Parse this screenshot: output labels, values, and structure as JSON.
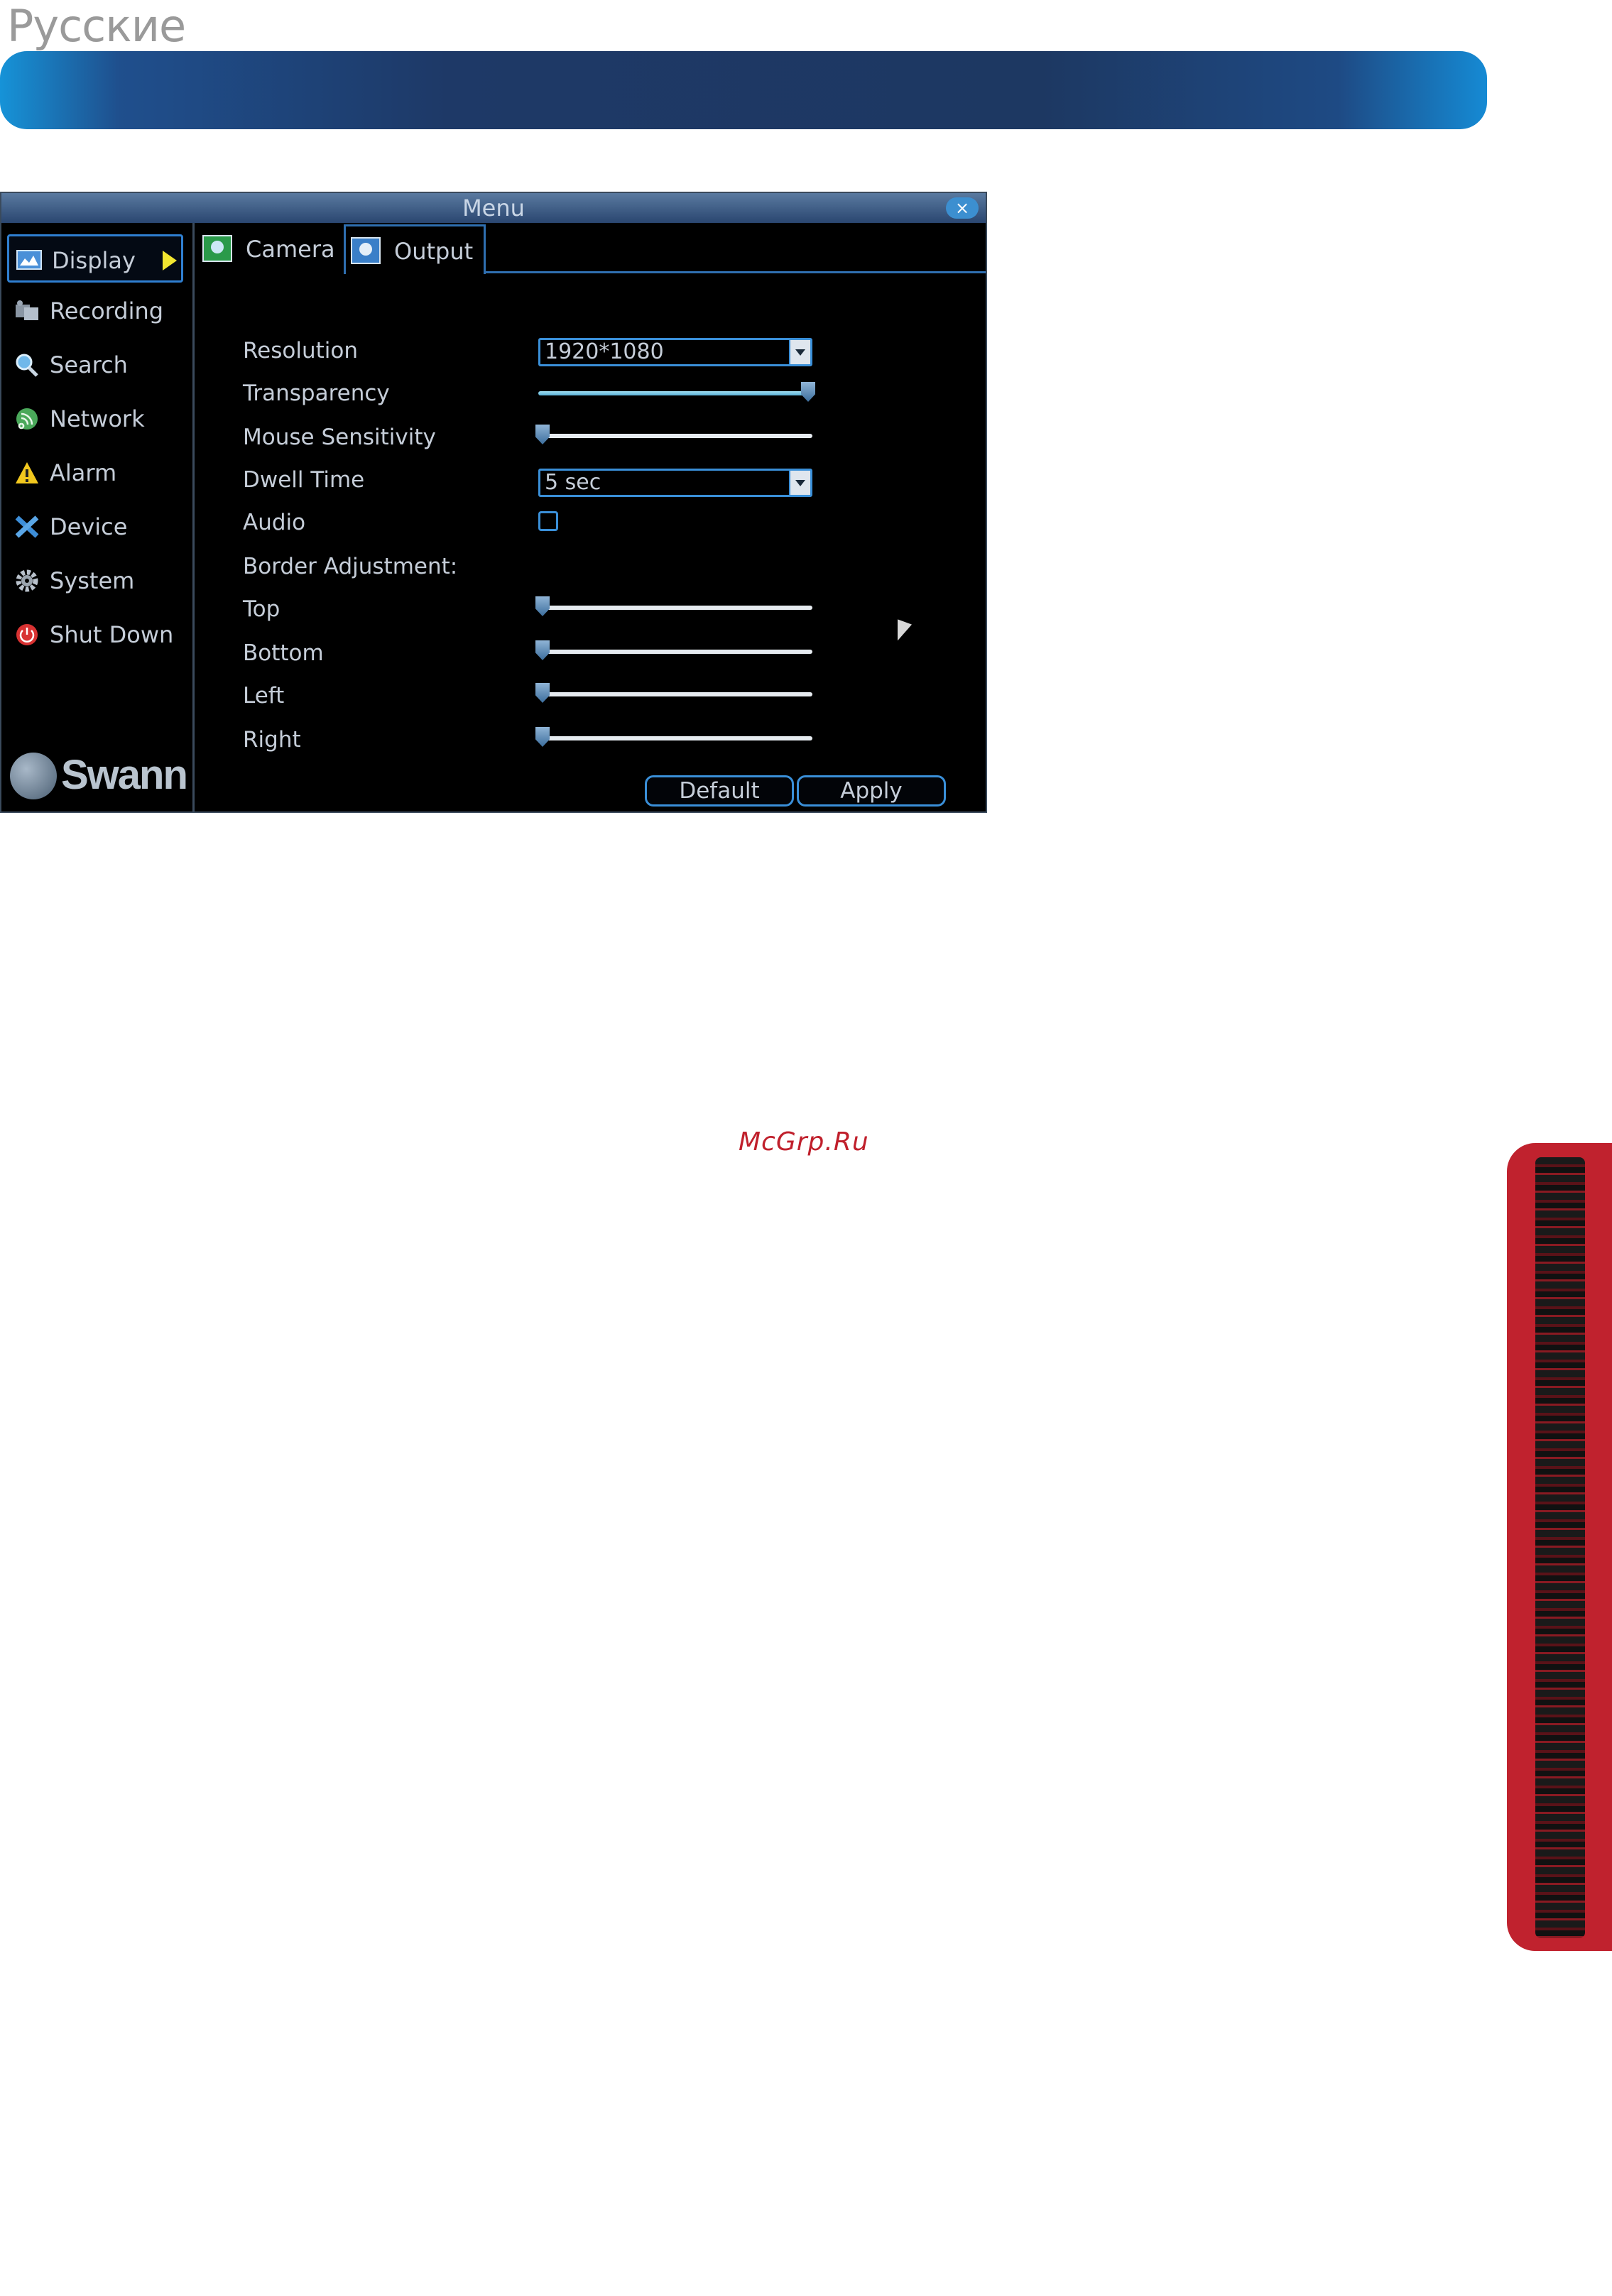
{
  "page": {
    "language_heading": "Русские",
    "watermark": "McGrp.Ru"
  },
  "window": {
    "title": "Menu",
    "close_label": "×"
  },
  "sidebar": {
    "items": [
      {
        "label": "Display",
        "icon": "display-icon",
        "active": true
      },
      {
        "label": "Recording",
        "icon": "recording-icon"
      },
      {
        "label": "Search",
        "icon": "search-icon"
      },
      {
        "label": "Network",
        "icon": "network-icon"
      },
      {
        "label": "Alarm",
        "icon": "alarm-icon"
      },
      {
        "label": "Device",
        "icon": "device-icon"
      },
      {
        "label": "System",
        "icon": "gear-icon"
      },
      {
        "label": "Shut Down",
        "icon": "power-icon"
      }
    ],
    "logo_text": "Swann"
  },
  "tabs": [
    {
      "label": "Camera",
      "icon": "camera-tab-icon",
      "active": false
    },
    {
      "label": "Output",
      "icon": "output-tab-icon",
      "active": true
    }
  ],
  "form": {
    "resolution": {
      "label": "Resolution",
      "value": "1920*1080"
    },
    "transparency": {
      "label": "Transparency",
      "level": 1.0
    },
    "mouse_sensitivity": {
      "label": "Mouse Sensitivity",
      "level": 0.0
    },
    "dwell_time": {
      "label": "Dwell Time",
      "value": "5 sec"
    },
    "audio": {
      "label": "Audio",
      "checked": false
    },
    "border_adjustment": {
      "label": "Border Adjustment:"
    },
    "top": {
      "label": "Top",
      "level": 0.0
    },
    "bottom": {
      "label": "Bottom",
      "level": 0.0
    },
    "left": {
      "label": "Left",
      "level": 0.0
    },
    "right": {
      "label": "Right",
      "level": 0.0
    }
  },
  "buttons": {
    "default": "Default",
    "apply": "Apply"
  },
  "colors": {
    "accent": "#3a8fd8",
    "background": "#000000",
    "text": "#c5cdd8",
    "side_tab": "#c0222e"
  }
}
